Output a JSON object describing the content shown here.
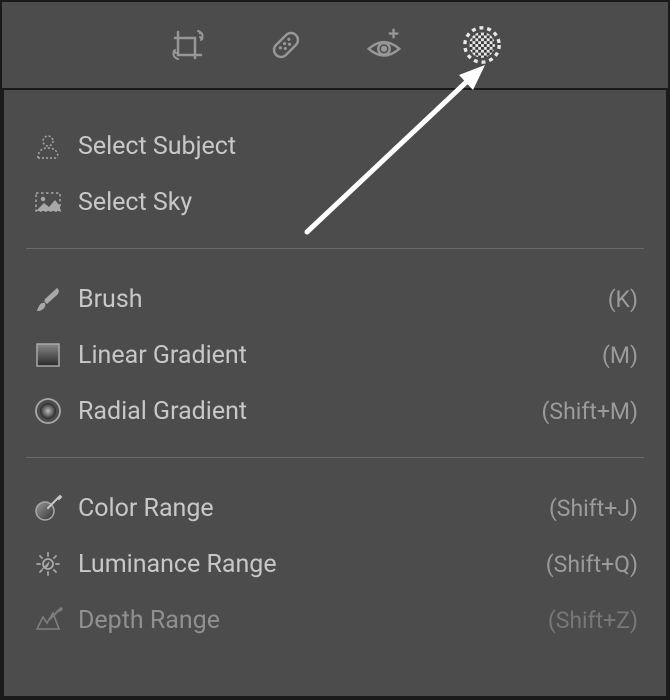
{
  "toolbar": {
    "crop": "crop-icon",
    "heal": "heal-icon",
    "redeye": "redeye-icon",
    "masking": "masking-icon"
  },
  "groups": [
    {
      "items": [
        {
          "icon": "person-icon",
          "label": "Select Subject",
          "shortcut": ""
        },
        {
          "icon": "landscape-icon",
          "label": "Select Sky",
          "shortcut": ""
        }
      ]
    },
    {
      "items": [
        {
          "icon": "brush-icon",
          "label": "Brush",
          "shortcut": "(K)"
        },
        {
          "icon": "linear-gradient-icon",
          "label": "Linear Gradient",
          "shortcut": "(M)"
        },
        {
          "icon": "radial-gradient-icon",
          "label": "Radial Gradient",
          "shortcut": "(Shift+M)"
        }
      ]
    },
    {
      "items": [
        {
          "icon": "color-range-icon",
          "label": "Color Range",
          "shortcut": "(Shift+J)"
        },
        {
          "icon": "luminance-range-icon",
          "label": "Luminance Range",
          "shortcut": "(Shift+Q)"
        },
        {
          "icon": "depth-range-icon",
          "label": "Depth Range",
          "shortcut": "(Shift+Z)",
          "disabled": true
        }
      ]
    }
  ]
}
